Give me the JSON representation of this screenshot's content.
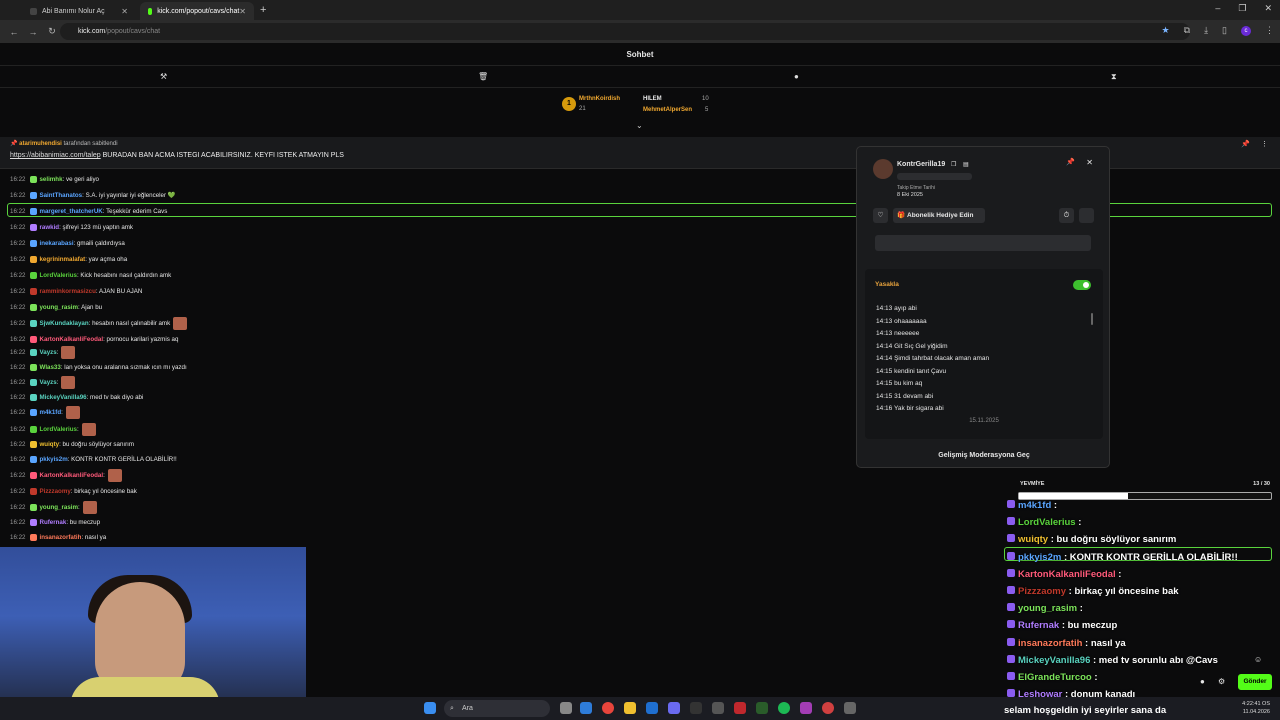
{
  "browser": {
    "tabs": [
      {
        "title": "Abi Banımı Nolur Aç"
      },
      {
        "title": "kick.com/popout/cavs/chat"
      }
    ],
    "url_host": "kick.com",
    "url_path": "/popout/cavs/chat"
  },
  "kick": {
    "header_title": "Sohbet",
    "leaderboard": [
      {
        "rank": "1",
        "name": "MrthnKoirdish",
        "count": "21"
      },
      {
        "name": "HILEM",
        "count": "10"
      },
      {
        "name": "MehmetAlperSen",
        "count": "5"
      }
    ],
    "pinned": {
      "by_user": "atarimuhendisi",
      "by_suffix": "tarafından sabitlendi",
      "link": "https://abibanimiac.com/talep",
      "text": " BURADAN BAN ACMA ISTEGI ACABILIRSINIZ. KEYFI ISTEK ATMAYIN PLS"
    },
    "messages": [
      {
        "time": "16:22",
        "user": "selimhk",
        "color": "#7ce35a",
        "text": ": ve geri aliyo"
      },
      {
        "time": "16:22",
        "user": "SaintThanatos",
        "color": "#5aa5ff",
        "text": ": S.A. iyi yayınlar iyi eğlenceler 💚"
      },
      {
        "time": "16:22",
        "user": "margeret_thatcherUK",
        "color": "#5aa5ff",
        "text": ": Teşekkür ederim Cavs"
      },
      {
        "time": "16:22",
        "user": "rawkid",
        "color": "#b07dff",
        "text": ": şifreyi 123 mü yaptın amk"
      },
      {
        "time": "16:22",
        "user": "inekarabasi",
        "color": "#5aa5ff",
        "text": ": gmaili çaldırdıysa"
      },
      {
        "time": "16:22",
        "user": "kegrininmalafat",
        "color": "#f0a830",
        "text": ": yav açma oha"
      },
      {
        "time": "16:22",
        "user": "LordValerius",
        "color": "#5ad33d",
        "text": ": Kick hesabını nasıl çaldırdın amk"
      },
      {
        "time": "16:22",
        "user": "ramminkormasizcu",
        "color": "#c0392b",
        "text": ": AJAN BU AJAN"
      },
      {
        "time": "16:22",
        "user": "young_rasim",
        "color": "#7ce35a",
        "text": ": Ajan bu"
      },
      {
        "time": "16:22",
        "user": "SjwKundaklayan",
        "color": "#5ad3c0",
        "text": ": hesabın nasıl çalınabilir amk"
      },
      {
        "time": "16:22",
        "user": "KartonKalkanliFeodal",
        "color": "#ff5a7a",
        "text": ": pornocu karilari yazmis aq"
      },
      {
        "time": "16:22",
        "user": "Vayzs",
        "color": "#5ad3c0",
        "text": ":"
      },
      {
        "time": "16:22",
        "user": "Wlas33",
        "color": "#7ce35a",
        "text": ": lan yoksa onu aralarına sızmak ıcın mı yazdı"
      },
      {
        "time": "16:22",
        "user": "Vayzs",
        "color": "#5ad3c0",
        "text": ":"
      },
      {
        "time": "16:22",
        "user": "MickeyVanilla96",
        "color": "#5ad3c0",
        "text": ": med tv bak diyo abi"
      },
      {
        "time": "16:22",
        "user": "m4k1fd",
        "color": "#5aa5ff",
        "text": ":"
      },
      {
        "time": "16:22",
        "user": "LordValerius",
        "color": "#5ad33d",
        "text": ":"
      },
      {
        "time": "16:22",
        "user": "wuiqty",
        "color": "#f0c030",
        "text": ": bu doğru söylüyor sanırım"
      },
      {
        "time": "16:22",
        "user": "pkkyis2m",
        "color": "#5aa5ff",
        "text": ": KONTR KONTR GERİLLA OLABİLİR!!"
      },
      {
        "time": "16:22",
        "user": "KartonKalkanliFeodal",
        "color": "#ff5a7a",
        "text": ":"
      },
      {
        "time": "16:22",
        "user": "Pizzzaomy",
        "color": "#c0392b",
        "text": ": birkaç yıl öncesine bak"
      },
      {
        "time": "16:22",
        "user": "young_rasim",
        "color": "#7ce35a",
        "text": ":"
      },
      {
        "time": "16:22",
        "user": "Rufernak",
        "color": "#b07dff",
        "text": ": bu meczup"
      },
      {
        "time": "16:22",
        "user": "insanazorfatih",
        "color": "#ff7a5a",
        "text": ": nasıl ya"
      }
    ],
    "card": {
      "username": "KontrGerilla19",
      "follow_label": "Takip Etme Tarihi",
      "follow_date": "8 Eki 2025",
      "gift_button": "Abonelik Hediye Edin",
      "mod_header": "Yasakla",
      "logs": [
        {
          "time": "14:13",
          "text": "ayıp abi"
        },
        {
          "time": "14:13",
          "text": "ohaaaaaaa"
        },
        {
          "time": "14:13",
          "text": "neeeeee"
        },
        {
          "time": "14:14",
          "text": "Git Sıç Gel yiğidim"
        },
        {
          "time": "14:14",
          "text": "Şimdi tahrbat olacak aman aman"
        },
        {
          "time": "14:15",
          "text": "kendini tanıt Çavu"
        },
        {
          "time": "14:15",
          "text": "bu kim aq"
        },
        {
          "time": "14:15",
          "text": "31 devam abi"
        },
        {
          "time": "14:16",
          "text": "Yak bir sigara abi"
        }
      ],
      "log_date": "15.11.2025",
      "advanced_button": "Gelişmiş Moderasyona Geç"
    },
    "send_button": "Gönder"
  },
  "overlay": {
    "goal_label": "YEVMİYE",
    "goal_value": "13 / 30",
    "goal_fraction": 0.433,
    "chat": [
      {
        "user": "m4k1fd",
        "color": "#5aa5ff",
        "text": " :"
      },
      {
        "user": "LordValerius",
        "color": "#5ad33d",
        "text": " :"
      },
      {
        "user": "wuiqty",
        "color": "#f0c030",
        "text": " : bu doğru söylüyor sanırım"
      },
      {
        "user": "pkkyis2m",
        "color": "#5aa5ff",
        "text": " : KONTR KONTR GERİLLA OLABİLİR!!"
      },
      {
        "user": "KartonKalkanliFeodal",
        "color": "#ff5a7a",
        "text": " :"
      },
      {
        "user": "Pizzzaomy",
        "color": "#c0392b",
        "text": " : birkaç yıl öncesine bak"
      },
      {
        "user": "young_rasim",
        "color": "#7ce35a",
        "text": " :"
      },
      {
        "user": "Rufernak",
        "color": "#b07dff",
        "text": " : bu meczup"
      },
      {
        "user": "insanazorfatih",
        "color": "#ff7a5a",
        "text": " : nasıl ya"
      },
      {
        "user": "MickeyVanilla96",
        "color": "#5ad3c0",
        "text": " : med tv sorunlu abı @Cavs"
      },
      {
        "user": "ElGrandeTurcoo",
        "color": "#7ce35a",
        "text": " :"
      },
      {
        "user": "Leshowar",
        "color": "#b07dff",
        "text": " : donum kanadı"
      }
    ],
    "welcome": "selam hoşgeldin iyi seyirler sana da"
  },
  "taskbar": {
    "search_placeholder": "Ara",
    "time": "4:22:41 OS",
    "date": "11.04.2026"
  }
}
